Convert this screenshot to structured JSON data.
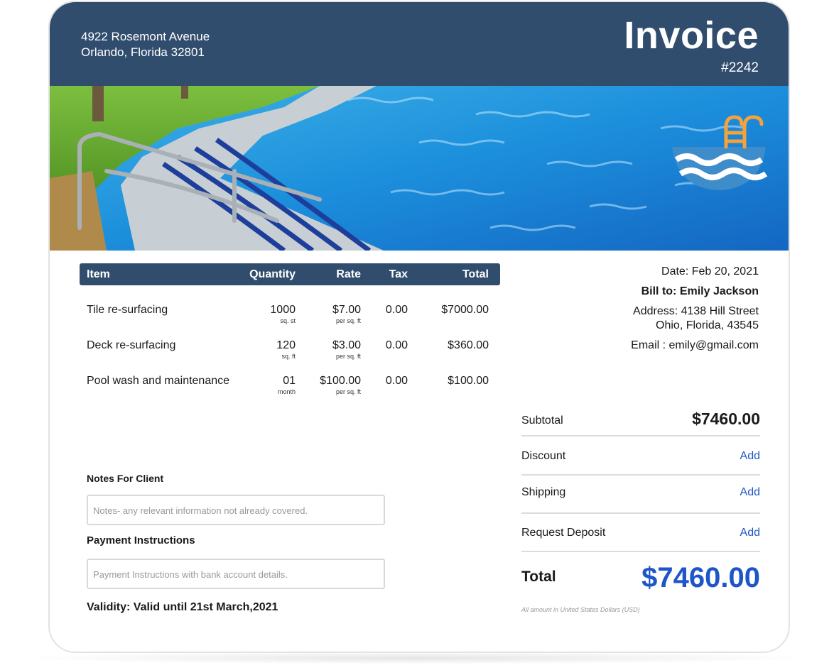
{
  "company": {
    "address_line1": "4922 Rosemont Avenue",
    "address_line2": "Orlando, Florida 32801"
  },
  "invoice": {
    "title": "Invoice",
    "number": "#2242"
  },
  "banner": {
    "icon": "pool-ladder-waves-icon",
    "colors": {
      "header": "#314d6e",
      "accent": "#1e56c8",
      "icon_orange": "#f5a23b",
      "icon_blue": "#3f8ccb"
    }
  },
  "table": {
    "headers": {
      "item": "Item",
      "quantity": "Quantity",
      "rate": "Rate",
      "tax": "Tax",
      "total": "Total"
    },
    "rows": [
      {
        "item": "Tile re-surfacing",
        "quantity": "1000",
        "quantity_unit": "sq. st",
        "rate": "$7.00",
        "rate_unit": "per sq. ft",
        "tax": "0.00",
        "total": "$7000.00"
      },
      {
        "item": "Deck re-surfacing",
        "quantity": "120",
        "quantity_unit": "sq. ft",
        "rate": "$3.00",
        "rate_unit": "per sq. ft",
        "tax": "0.00",
        "total": "$360.00"
      },
      {
        "item": "Pool wash and maintenance",
        "quantity": "01",
        "quantity_unit": "month",
        "rate": "$100.00",
        "rate_unit": "per sq. ft",
        "tax": "0.00",
        "total": "$100.00"
      }
    ]
  },
  "notes": {
    "label": "Notes For Client",
    "placeholder": "Notes- any relevant information not already covered."
  },
  "payment": {
    "label": "Payment Instructions",
    "placeholder": "Payment Instructions with bank account details."
  },
  "validity": "Validity: Valid until 21st March,2021",
  "client": {
    "date": "Date: Feb 20, 2021",
    "bill_to": "Bill to: Emily Jackson",
    "address_line1": "Address: 4138 Hill Street",
    "address_line2": "Ohio, Florida, 43545",
    "email": "Email : emily@gmail.com"
  },
  "summary": {
    "subtotal_label": "Subtotal",
    "subtotal_value": "$7460.00",
    "discount_label": "Discount",
    "shipping_label": "Shipping",
    "deposit_label": "Request Deposit",
    "add_label": "Add",
    "total_label": "Total",
    "total_value": "$7460.00",
    "currency_note": "All amount in United States Dollars (USD)"
  }
}
